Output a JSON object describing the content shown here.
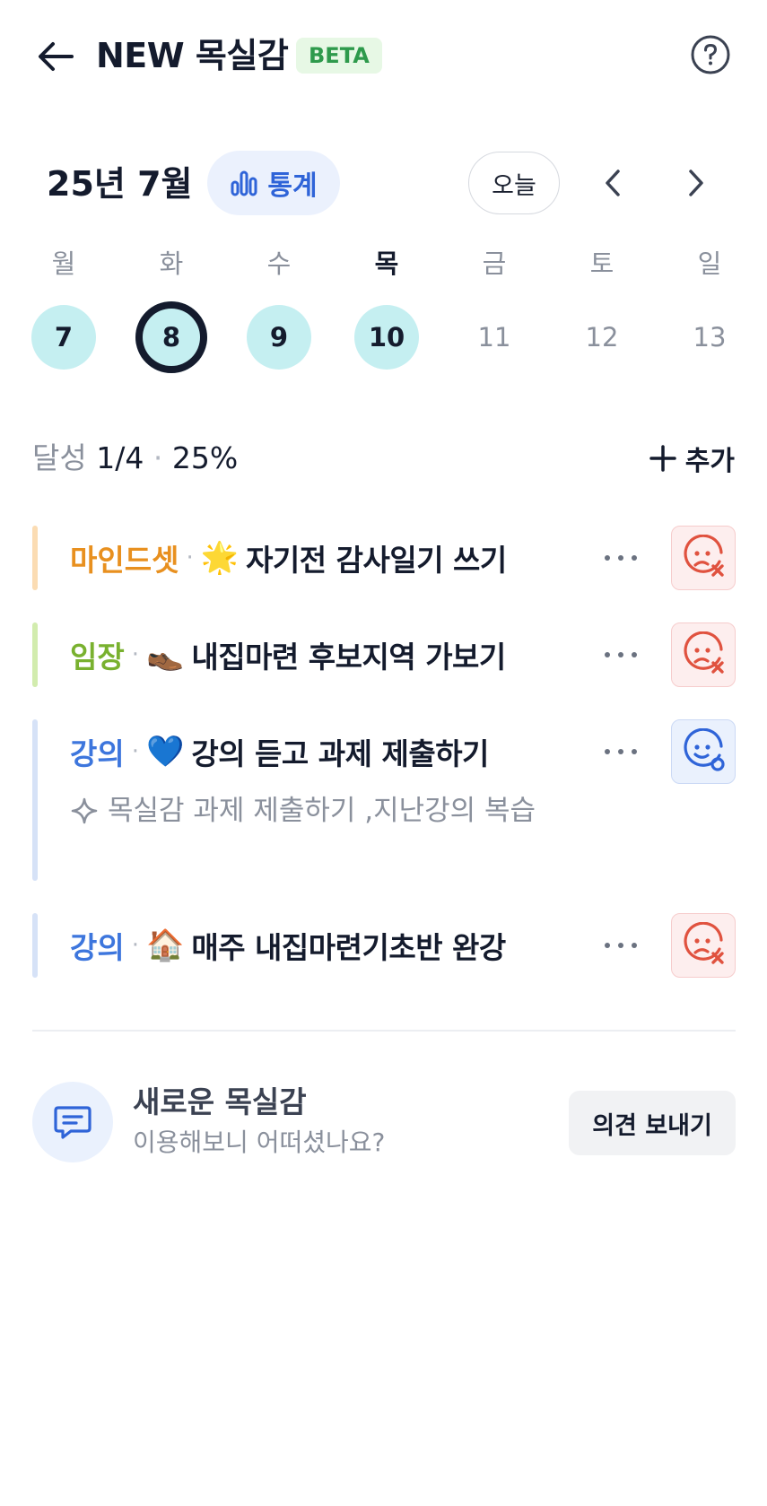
{
  "header": {
    "title": "NEW 목실감",
    "badge": "BETA",
    "back_icon": "arrow-left-icon",
    "help_icon": "question-circle-icon"
  },
  "calendar": {
    "month_label": "25년 7월",
    "stats_label": "통계",
    "today_label": "오늘",
    "weekdays": [
      "월",
      "화",
      "수",
      "목",
      "금",
      "토",
      "일"
    ],
    "dates": [
      "7",
      "8",
      "9",
      "10",
      "11",
      "12",
      "13"
    ],
    "selected_date": "8",
    "today_weekday": "목"
  },
  "progress": {
    "label": "달성",
    "count": "1/4",
    "separator": "·",
    "percent": "25%",
    "add_label": "추가"
  },
  "goals": [
    {
      "category": "마인드셋",
      "category_color": "#e8901f",
      "bar_color": "#fbdcb3",
      "emoji": "🌟",
      "title": "자기전 감사일기 쓰기",
      "status": "failed",
      "status_icon": "sad-face-x-icon"
    },
    {
      "category": "임장",
      "category_color": "#79b12f",
      "bar_color": "#d2ecae",
      "emoji": "👞",
      "title": "내집마련 후보지역 가보기",
      "status": "failed",
      "status_icon": "sad-face-x-icon"
    },
    {
      "category": "강의",
      "category_color": "#3d76dd",
      "bar_color": "#d6e2f7",
      "emoji": "💙",
      "title": "강의 듣고 과제 제출하기",
      "note": "목실감 과제 제출하기 ,지난강의 복습",
      "status": "done",
      "status_icon": "smile-face-check-icon"
    },
    {
      "category": "강의",
      "category_color": "#3d76dd",
      "bar_color": "#d6e2f7",
      "emoji": "🏠",
      "title": "매주 내집마련기초반 완강",
      "status": "failed",
      "status_icon": "sad-face-x-icon"
    }
  ],
  "feedback": {
    "title": "새로운 목실감",
    "subtitle": "이용해보니 어떠셨나요?",
    "button_label": "의견 보내기",
    "icon": "chat-bubble-icon"
  },
  "colors": {
    "primary": "#2f64d8",
    "selected_date_ring": "#141b2d",
    "date_fill": "#c5eff1",
    "failed": "#e0523f",
    "done": "#2f64d8"
  }
}
